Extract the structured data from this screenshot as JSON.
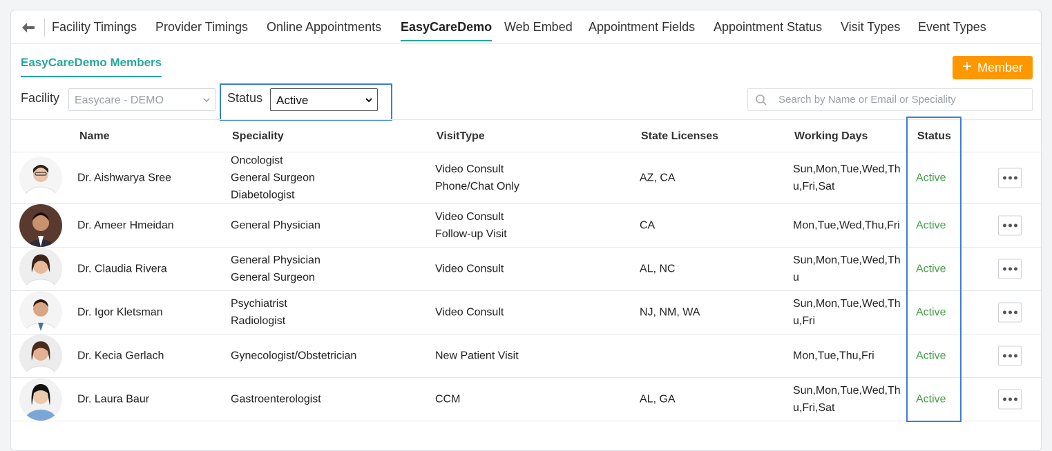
{
  "tabs": [
    {
      "label": "Facility Timings",
      "active": false
    },
    {
      "label": "Provider Timings",
      "active": false
    },
    {
      "label": "Online Appointments",
      "active": false
    },
    {
      "label": "EasyCareDemo",
      "active": true
    },
    {
      "label": "Web Embed",
      "active": false
    },
    {
      "label": "Appointment Fields",
      "active": false
    },
    {
      "label": "Appointment Status",
      "active": false
    },
    {
      "label": "Visit Types",
      "active": false
    },
    {
      "label": "Event Types",
      "active": false
    }
  ],
  "subheader": {
    "title": "EasyCareDemo Members",
    "add_button": "Member"
  },
  "filters": {
    "facility_label": "Facility",
    "facility_value": "Easycare - DEMO",
    "status_label": "Status",
    "status_value": "Active",
    "search_placeholder": "Search by Name or Email or Speciality"
  },
  "columns": [
    "Name",
    "Speciality",
    "VisitType",
    "State Licenses",
    "Working Days",
    "Status"
  ],
  "rows": [
    {
      "name": "Dr. Aishwarya Sree",
      "speciality": [
        "Oncologist",
        "General Surgeon",
        "Diabetologist"
      ],
      "visit": [
        "Video Consult",
        "Phone/Chat Only"
      ],
      "licenses": "AZ, CA",
      "days": [
        "Sun,Mon,Tue,Wed,Th",
        "u,Fri,Sat"
      ],
      "status": "Active"
    },
    {
      "name": "Dr. Ameer Hmeidan",
      "speciality": [
        "General Physician"
      ],
      "visit": [
        "Video Consult",
        "Follow-up Visit"
      ],
      "licenses": "CA",
      "days": [
        "Mon,Tue,Wed,Thu,Fri"
      ],
      "status": "Active"
    },
    {
      "name": "Dr. Claudia Rivera",
      "speciality": [
        "General Physician",
        "General Surgeon"
      ],
      "visit": [
        "Video Consult"
      ],
      "licenses": "AL, NC",
      "days": [
        "Sun,Mon,Tue,Wed,Th",
        "u"
      ],
      "status": "Active"
    },
    {
      "name": "Dr. Igor Kletsman",
      "speciality": [
        "Psychiatrist",
        "Radiologist"
      ],
      "visit": [
        "Video Consult"
      ],
      "licenses": "NJ, NM, WA",
      "days": [
        "Sun,Mon,Tue,Wed,Th",
        "u,Fri"
      ],
      "status": "Active"
    },
    {
      "name": "Dr. Kecia Gerlach",
      "speciality": [
        "Gynecologist/Obstetrician"
      ],
      "visit": [
        "New Patient Visit"
      ],
      "licenses": "",
      "days": [
        "Mon,Tue,Thu,Fri"
      ],
      "status": "Active"
    },
    {
      "name": "Dr. Laura Baur",
      "speciality": [
        "Gastroenterologist"
      ],
      "visit": [
        "CCM"
      ],
      "licenses": "AL, GA",
      "days": [
        "Sun,Mon,Tue,Wed,Th",
        "u,Fri,Sat"
      ],
      "status": "Active"
    }
  ],
  "colors": {
    "accent": "#26a69a",
    "button": "#ff9800",
    "active_status": "#43a047",
    "highlight": "#3b7ddd"
  }
}
